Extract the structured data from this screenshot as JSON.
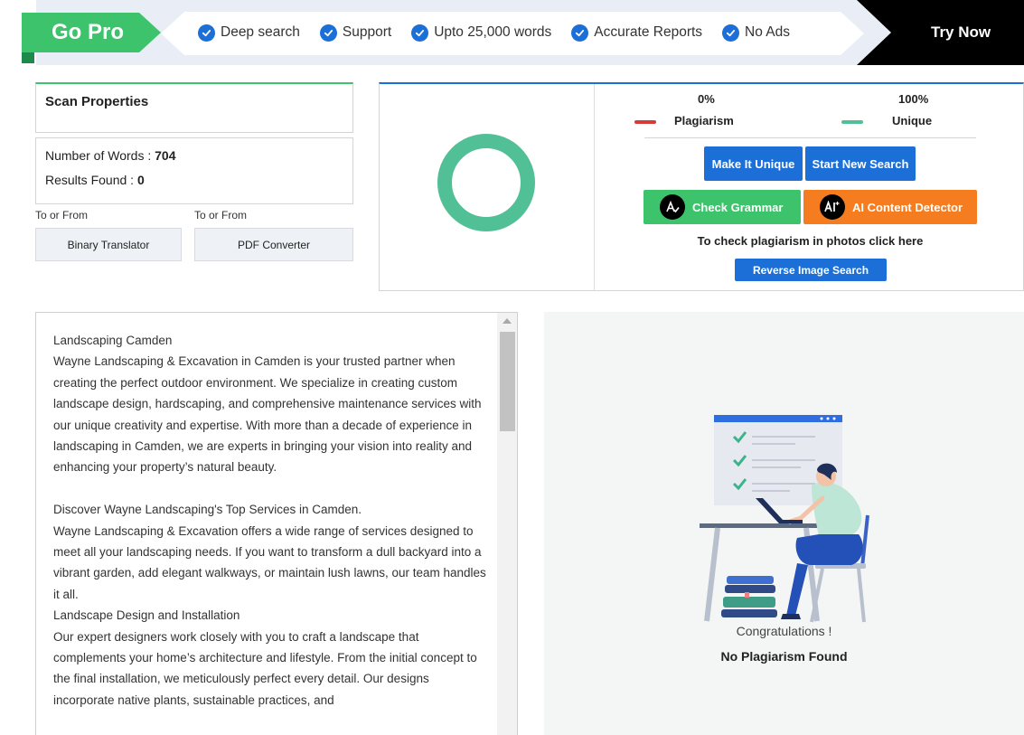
{
  "promo": {
    "go_pro": "Go Pro",
    "features": [
      "Deep search",
      "Support",
      "Upto 25,000 words",
      "Accurate Reports",
      "No Ads"
    ],
    "try_now": "Try Now"
  },
  "scan": {
    "title": "Scan Properties",
    "words_label": "Number of Words : ",
    "words_value": "704",
    "results_label": "Results Found : ",
    "results_value": "0"
  },
  "tools": [
    {
      "label": "To or From",
      "button": "Binary Translator"
    },
    {
      "label": "To or From",
      "button": "PDF Converter"
    }
  ],
  "results": {
    "plagiarism_percent": "0%",
    "plagiarism_label": "Plagiarism",
    "unique_percent": "100%",
    "unique_label": "Unique",
    "unique_fraction": 1.0,
    "make_unique": "Make It Unique",
    "start_new": "Start New Search",
    "check_grammar": "Check Grammar",
    "ai_detector": "AI Content Detector",
    "photo_note": "To check plagiarism in photos click here",
    "reverse_image": "Reverse Image Search"
  },
  "colors": {
    "plagiarism": "#d63b3b",
    "unique": "#52c096",
    "primary": "#1b6fd6",
    "green_button": "#3cc36b",
    "orange_button": "#f57c1f"
  },
  "icons": {
    "feature_check": "check-circle-icon",
    "grammar": "grammar-icon",
    "ai": "ai-icon",
    "illustration": "person-laptop-illustration"
  },
  "editor": {
    "paragraphs": [
      "Landscaping Camden",
      "Wayne Landscaping & Excavation in Camden is your trusted partner when creating the perfect outdoor environment. We specialize in creating custom landscape design, hardscaping, and comprehensive maintenance services with our unique creativity and expertise. With more than a decade of experience in landscaping in Camden, we are experts in bringing your vision into reality and enhancing your property’s natural beauty.",
      "",
      "Discover Wayne Landscaping's Top Services in Camden.",
      "Wayne Landscaping & Excavation offers a wide range of services designed to meet all your landscaping needs. If you want to transform a dull backyard into a vibrant garden, add elegant walkways, or maintain lush lawns, our team handles it all.",
      "Landscape Design and Installation",
      "Our expert designers work closely with you to craft a landscape that complements your home’s architecture and lifestyle. From the initial concept to the final installation, we meticulously perfect every detail. Our designs incorporate native plants, sustainable practices, and"
    ]
  },
  "outcome": {
    "congrats": "Congratulations !",
    "message": "No Plagiarism Found"
  }
}
